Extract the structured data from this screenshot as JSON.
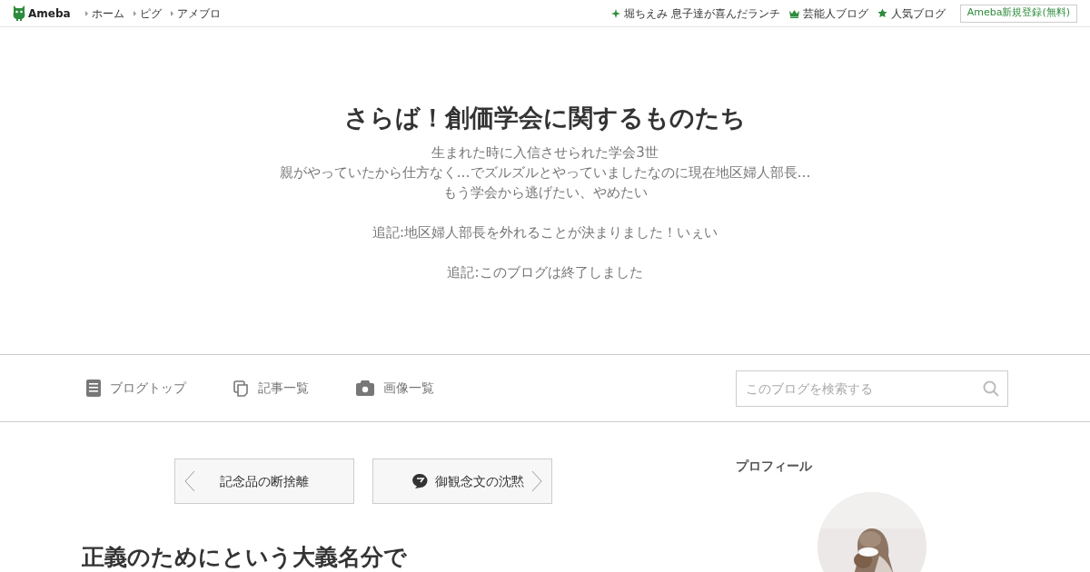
{
  "topbar": {
    "logo": "Ameba",
    "breadcrumbs": [
      "ホーム",
      "ピグ",
      "アメブロ"
    ],
    "links": [
      {
        "kind": "sparkle",
        "label": "堀ちえみ 息子達が喜んだランチ"
      },
      {
        "kind": "crown",
        "label": "芸能人ブログ"
      },
      {
        "kind": "star",
        "label": "人気ブログ"
      }
    ],
    "signup": "Ameba新規登録(無料)"
  },
  "blog": {
    "title": "さらば！創価学会に関するものたち",
    "paragraphs": [
      [
        "生まれた時に入信させられた学会3世",
        "親がやっていたから仕方なく…でズルズルとやっていましたなのに現在地区婦人部長…",
        "もう学会から逃げたい、やめたい"
      ],
      [
        "追記:地区婦人部長を外れることが決まりました！いぇい"
      ],
      [
        "追記:このブログは終了しました"
      ]
    ]
  },
  "nav": {
    "items": [
      {
        "kind": "document",
        "label": "ブログトップ"
      },
      {
        "kind": "copy",
        "label": "記事一覧"
      },
      {
        "kind": "camera",
        "label": "画像一覧"
      }
    ],
    "search": {
      "placeholder": "このブログを検索する"
    }
  },
  "pager": {
    "prev": {
      "label": "記念品の断捨離"
    },
    "next": {
      "label": "御観念文の沈黙"
    }
  },
  "article": {
    "title": "正義のためにという大義名分で"
  },
  "profile": {
    "heading": "プロフィール"
  }
}
